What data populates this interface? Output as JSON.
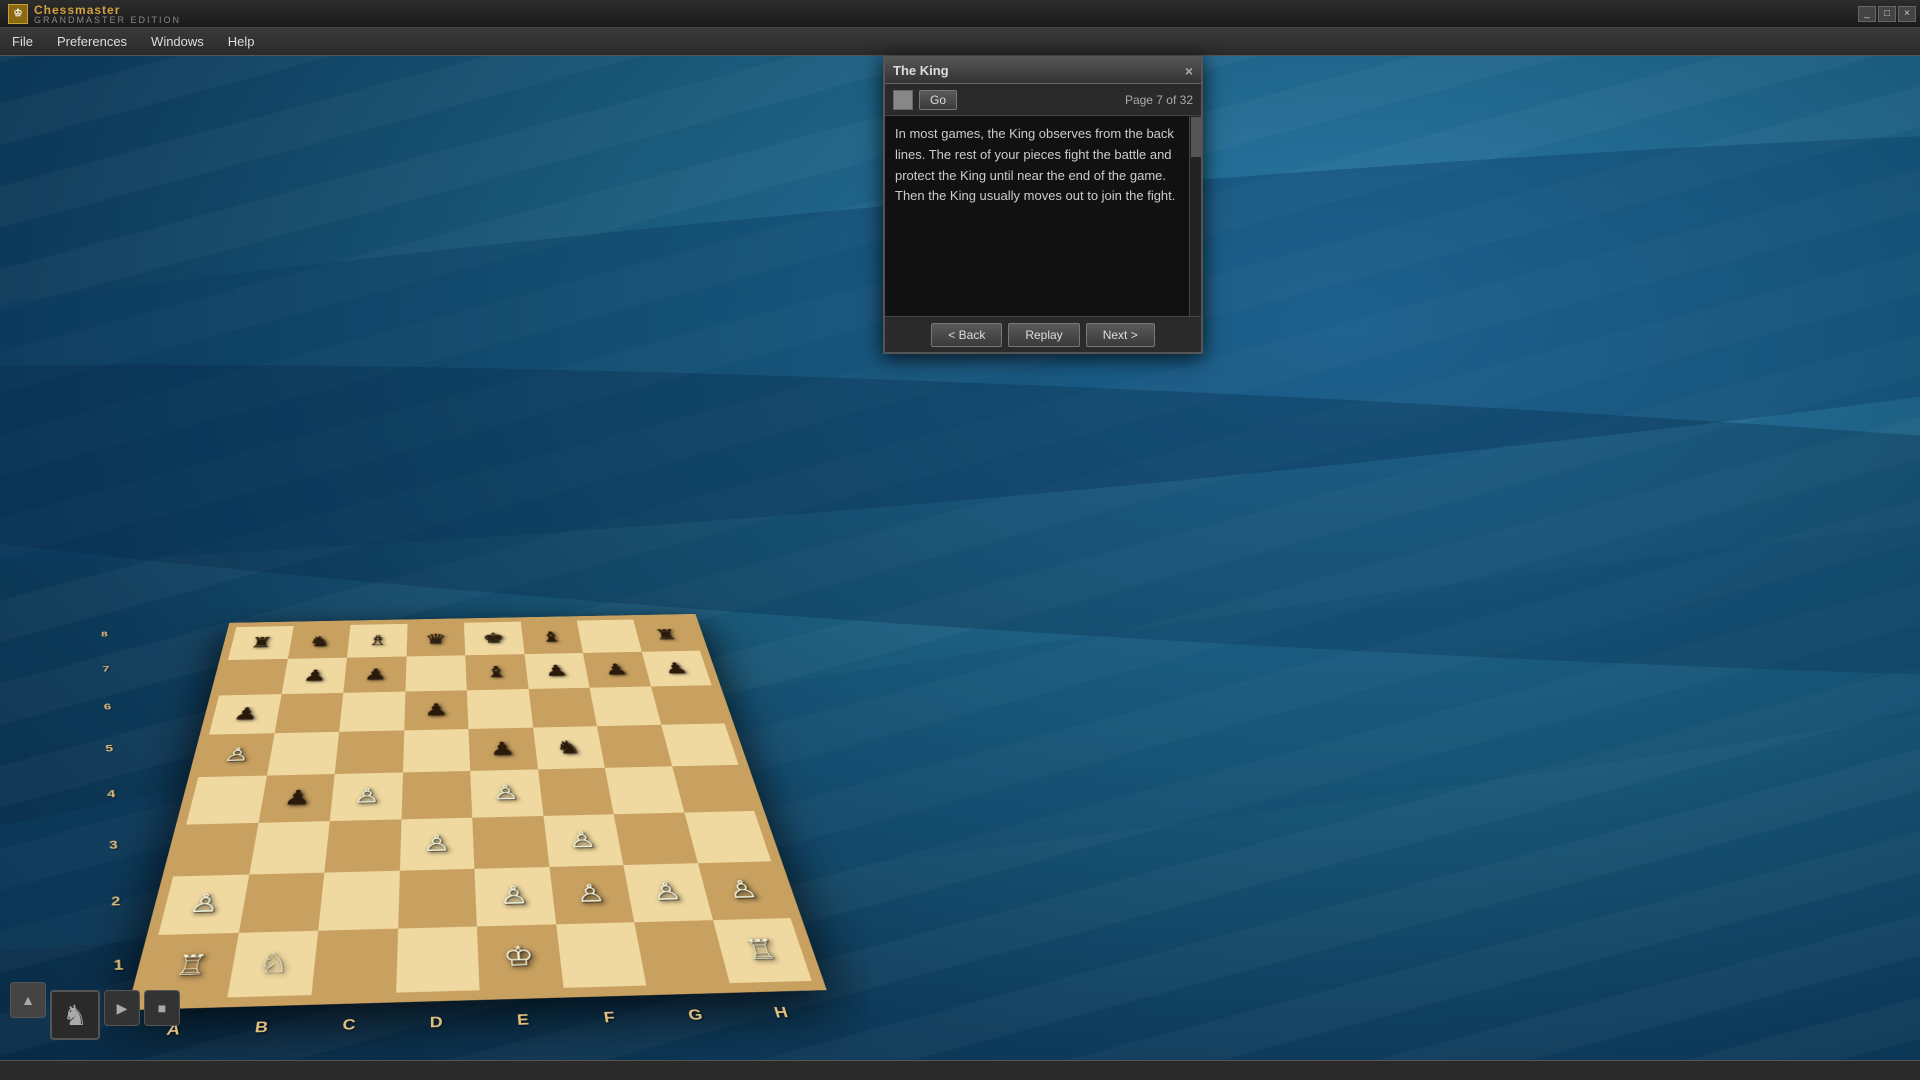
{
  "app": {
    "title": "Chessmaster",
    "subtitle": "GRANDMASTER EDITION"
  },
  "titlebar": {
    "controls": [
      "_",
      "□",
      "×"
    ]
  },
  "menubar": {
    "items": [
      "File",
      "Preferences",
      "Windows",
      "Help"
    ]
  },
  "tutorial_panel": {
    "title": "The King",
    "close_label": "×",
    "go_button": "Go",
    "page_info": "Page 7 of 32",
    "content": "In most games, the King observes from the back lines. The rest of your pieces fight the battle and protect the King until near the end of the game. Then the King usually moves out to join the fight.",
    "nav": {
      "back": "< Back",
      "replay": "Replay",
      "next": "Next >"
    }
  },
  "board": {
    "rank_labels": [
      "8",
      "7",
      "6",
      "5",
      "4",
      "3",
      "2",
      "1"
    ],
    "file_labels": [
      "A",
      "B",
      "C",
      "D",
      "E",
      "F",
      "G",
      "H"
    ],
    "pieces": [
      [
        "♜",
        "♞",
        "♗",
        "♛",
        "♚",
        "♝",
        "·",
        "♜"
      ],
      [
        "·",
        "♟",
        "♟",
        "·",
        "♝",
        "♟",
        "♟",
        "♟"
      ],
      [
        "♟",
        "·",
        "·",
        "♟",
        "·",
        "·",
        "·",
        "·"
      ],
      [
        "♙",
        "·",
        "·",
        "·",
        "♟",
        "♞",
        "·",
        "·"
      ],
      [
        "·",
        "♟",
        "♙",
        "·",
        "♙",
        "·",
        "·",
        "·"
      ],
      [
        "·",
        "·",
        "·",
        "♙",
        "·",
        "♙",
        "·",
        "·"
      ],
      [
        "♙",
        "·",
        "·",
        "·",
        "♙",
        "♙",
        "♙",
        "♙"
      ],
      [
        "♖",
        "♘",
        "·",
        "·",
        "♔",
        "·",
        "·",
        "♖"
      ]
    ],
    "piece_colors": [
      [
        "b",
        "b",
        "b",
        "b",
        "b",
        "b",
        "",
        "b"
      ],
      [
        "",
        "b",
        "b",
        "",
        "b",
        "b",
        "b",
        "b"
      ],
      [
        "b",
        "",
        "",
        "b",
        "",
        "",
        "",
        ""
      ],
      [
        "w",
        "",
        "",
        "",
        "b",
        "b",
        "",
        ""
      ],
      [
        "",
        "b",
        "w",
        "",
        "w",
        "",
        "",
        ""
      ],
      [
        "",
        "",
        "",
        "w",
        "",
        "w",
        "",
        ""
      ],
      [
        "w",
        "",
        "",
        "",
        "w",
        "w",
        "w",
        "w"
      ],
      [
        "w",
        "w",
        "",
        "",
        "w",
        "",
        "",
        "w"
      ]
    ]
  },
  "controls": {
    "arrow_up": "▲",
    "play": "▶",
    "stop": "■"
  }
}
